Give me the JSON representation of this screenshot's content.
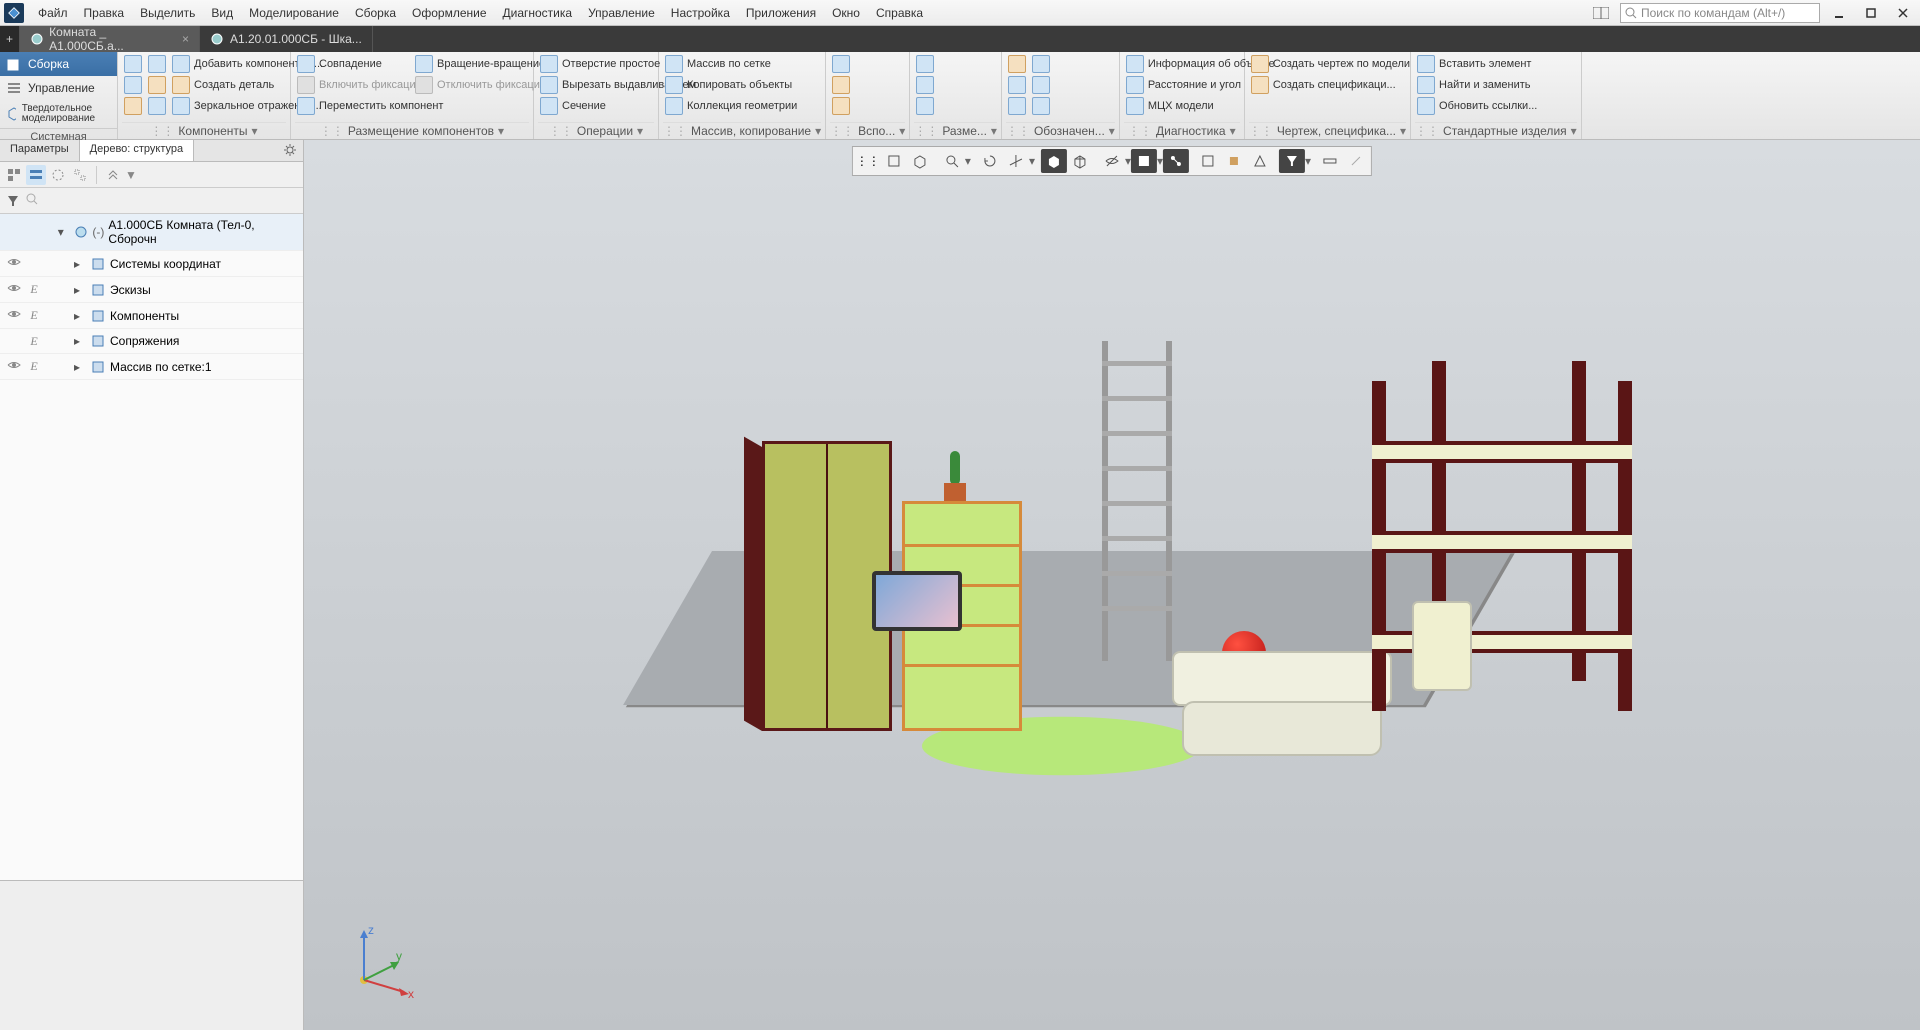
{
  "menu": [
    "Файл",
    "Правка",
    "Выделить",
    "Вид",
    "Моделирование",
    "Сборка",
    "Оформление",
    "Диагностика",
    "Управление",
    "Настройка",
    "Приложения",
    "Окно",
    "Справка"
  ],
  "search_placeholder": "Поиск по командам (Alt+/)",
  "tabs": [
    {
      "label": "Комната _ А1.000СБ.a...",
      "active": true
    },
    {
      "label": "А1.20.01.000СБ - Шка...",
      "active": false
    }
  ],
  "ribbon_left": {
    "buttons": [
      {
        "label": "Сборка",
        "active": true
      },
      {
        "label": "Управление",
        "active": false
      },
      {
        "label": "Твердотельное моделирование",
        "active": false
      }
    ],
    "footer": "Системная"
  },
  "ribbon_groups": [
    {
      "label": "Компоненты",
      "cmds": [
        [
          {
            "t": "",
            "c": "blue"
          },
          {
            "t": "",
            "c": "blue"
          },
          {
            "t": "",
            "c": "orange"
          }
        ],
        [
          {
            "t": "",
            "c": "blue"
          },
          {
            "t": "",
            "c": "orange"
          },
          {
            "t": "",
            "c": "blue"
          }
        ]
      ],
      "twocol": [
        {
          "t": "Добавить компонент из...",
          "c": "blue"
        },
        {
          "t": "Создать деталь",
          "c": "orange"
        },
        {
          "t": "Зеркальное отражение...",
          "c": "blue"
        }
      ]
    },
    {
      "label": "Размещение компонентов",
      "cmds": [
        {
          "t": "Совпадение",
          "c": "blue"
        },
        {
          "t": "Включить фиксацию",
          "c": "",
          "disabled": true
        },
        {
          "t": "Переместить компонент",
          "c": "blue"
        }
      ],
      "cmds2": [
        {
          "t": "Вращение-вращение",
          "c": "blue"
        },
        {
          "t": "Отключить фиксацию",
          "c": "",
          "disabled": true
        }
      ]
    },
    {
      "label": "Операции",
      "cmds": [
        {
          "t": "Отверстие простое",
          "c": "blue"
        },
        {
          "t": "Вырезать выдавливанием",
          "c": "blue"
        },
        {
          "t": "Сечение",
          "c": "blue"
        }
      ]
    },
    {
      "label": "Массив, копирование",
      "cmds": [
        {
          "t": "Массив по сетке",
          "c": "blue"
        },
        {
          "t": "Копировать объекты",
          "c": "blue"
        },
        {
          "t": "Коллекция геометрии",
          "c": "blue"
        }
      ]
    },
    {
      "label": "Вспо...",
      "iconsonly": 3
    },
    {
      "label": "Разме...",
      "iconsonly": 3
    },
    {
      "label": "Обозначен...",
      "iconsonly": 6
    },
    {
      "label": "Диагностика",
      "cmds": [
        {
          "t": "Информация об объекте",
          "c": "blue"
        },
        {
          "t": "Расстояние и угол",
          "c": "blue"
        },
        {
          "t": "МЦХ модели",
          "c": "blue"
        }
      ]
    },
    {
      "label": "Чертеж, специфика...",
      "cmds": [
        {
          "t": "Создать чертеж по модели",
          "c": "orange"
        },
        {
          "t": "Создать спецификаци...",
          "c": "orange"
        }
      ]
    },
    {
      "label": "Стандартные изделия",
      "cmds": [
        {
          "t": "Вставить элемент",
          "c": "blue"
        },
        {
          "t": "Найти и заменить",
          "c": "blue"
        },
        {
          "t": "Обновить ссылки...",
          "c": "blue"
        }
      ]
    }
  ],
  "left_panel": {
    "tabs": [
      "Параметры",
      "Дерево: структура"
    ],
    "active_tab": 1
  },
  "tree": {
    "root": "А1.000СБ Комната (Тел-0, Сборочн",
    "nodes": [
      {
        "label": "Системы координат",
        "vis": true,
        "inc": false
      },
      {
        "label": "Эскизы",
        "vis": true,
        "inc": true
      },
      {
        "label": "Компоненты",
        "vis": true,
        "inc": true
      },
      {
        "label": "Сопряжения",
        "vis": false,
        "inc": true
      },
      {
        "label": "Массив по сетке:1",
        "vis": true,
        "inc": true
      }
    ]
  },
  "axis": {
    "x": "x",
    "y": "y",
    "z": "z"
  }
}
